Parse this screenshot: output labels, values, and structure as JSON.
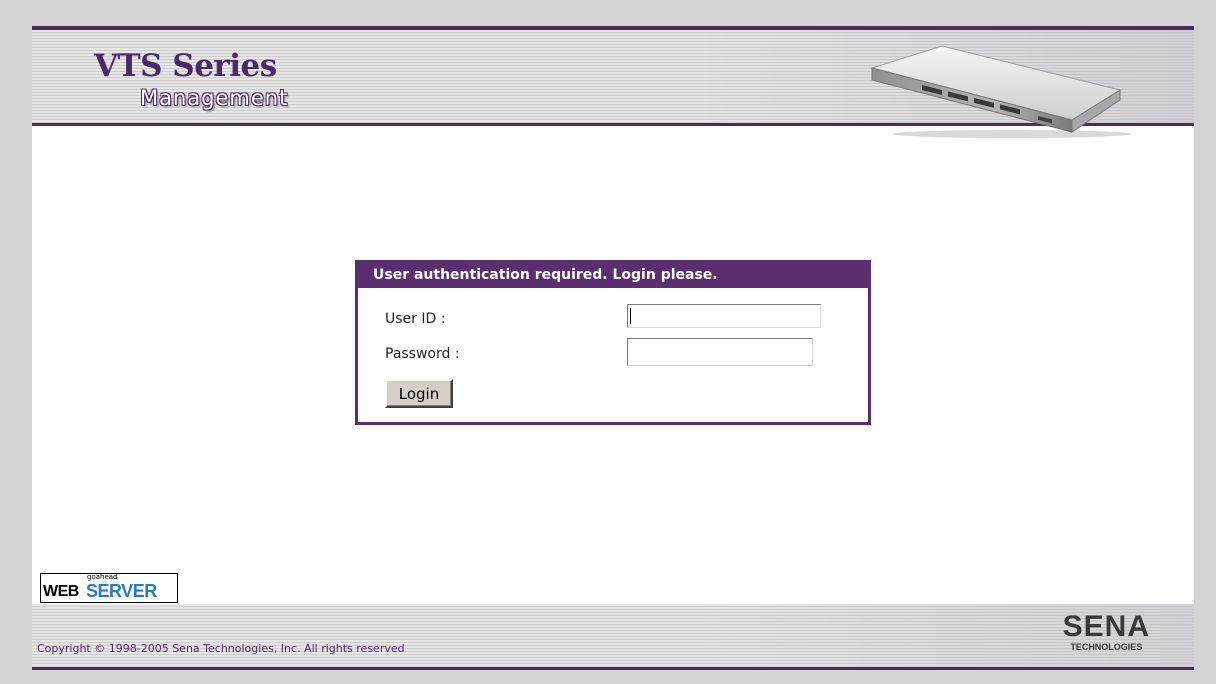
{
  "header": {
    "title": "VTS Series",
    "subtitle": "Management",
    "device_image": "vts-device-image"
  },
  "login": {
    "heading": "User authentication required. Login please.",
    "user_label": "User ID :",
    "user_value": "",
    "password_label": "Password :",
    "password_value": "",
    "button_label": "Login"
  },
  "badge": {
    "small": "goahead",
    "web": "WEB",
    "server": "SERVER"
  },
  "footer": {
    "copyright": "Copyright © 1998-2005 Sena Technologies, Inc. All rights reserved",
    "logo_main": "SENA",
    "logo_sub": "TECHNOLOGIES"
  },
  "colors": {
    "accent": "#5b2e6f",
    "title": "#4b2a68",
    "badge_blue": "#2a78c8"
  }
}
